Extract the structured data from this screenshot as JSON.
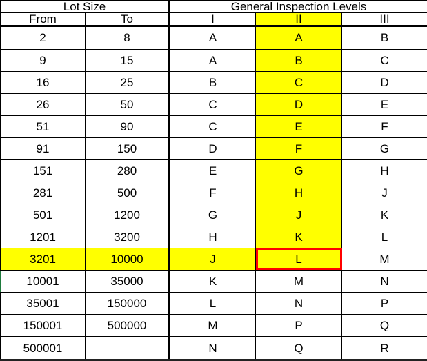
{
  "table": {
    "group_headers": [
      {
        "label": "Lot Size",
        "span": 2
      },
      {
        "label": "General Inspection Levels",
        "span": 3
      }
    ],
    "column_headers": [
      {
        "label": "From",
        "highlight": false
      },
      {
        "label": "To",
        "highlight": false
      },
      {
        "label": "I",
        "highlight": false
      },
      {
        "label": "II",
        "highlight": true
      },
      {
        "label": "III",
        "highlight": false
      }
    ],
    "rows": [
      {
        "from": "2",
        "to": "8",
        "level1": "A",
        "level2": "A",
        "level3": "B"
      },
      {
        "from": "9",
        "to": "15",
        "level1": "A",
        "level2": "B",
        "level3": "C"
      },
      {
        "from": "16",
        "to": "25",
        "level1": "B",
        "level2": "C",
        "level3": "D"
      },
      {
        "from": "26",
        "to": "50",
        "level1": "C",
        "level2": "D",
        "level3": "E"
      },
      {
        "from": "51",
        "to": "90",
        "level1": "C",
        "level2": "E",
        "level3": "F"
      },
      {
        "from": "91",
        "to": "150",
        "level1": "D",
        "level2": "F",
        "level3": "G"
      },
      {
        "from": "151",
        "to": "280",
        "level1": "E",
        "level2": "G",
        "level3": "H"
      },
      {
        "from": "281",
        "to": "500",
        "level1": "F",
        "level2": "H",
        "level3": "J"
      },
      {
        "from": "501",
        "to": "1200",
        "level1": "G",
        "level2": "J",
        "level3": "K"
      },
      {
        "from": "1201",
        "to": "3200",
        "level1": "H",
        "level2": "K",
        "level3": "L"
      },
      {
        "from": "3201",
        "to": "10000",
        "level1": "J",
        "level2": "L",
        "level3": "M"
      },
      {
        "from": "10001",
        "to": "35000",
        "level1": "K",
        "level2": "M",
        "level3": "N"
      },
      {
        "from": "35001",
        "to": "150000",
        "level1": "L",
        "level2": "N",
        "level3": "P"
      },
      {
        "from": "150001",
        "to": "500000",
        "level1": "M",
        "level2": "P",
        "level3": "Q"
      },
      {
        "from": "500001",
        "to": "",
        "level1": "N",
        "level2": "Q",
        "level3": "R"
      }
    ],
    "highlight": {
      "color": "#FFFF00",
      "level2_column_rows": [
        0,
        1,
        2,
        3,
        4,
        5,
        6,
        7,
        8,
        9,
        10
      ],
      "lot_size_row_index": 10
    },
    "selection": {
      "outline_color": "#FF0000",
      "row_index": 10,
      "column": "level2",
      "value": "L"
    }
  }
}
